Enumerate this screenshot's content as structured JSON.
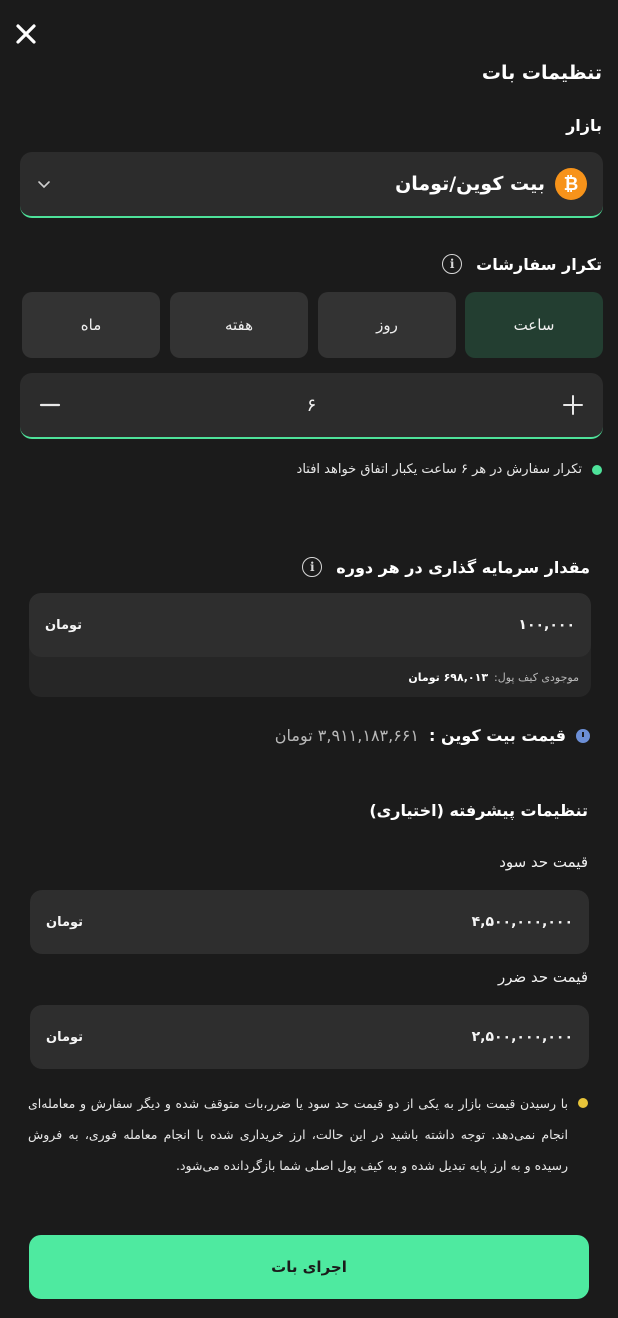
{
  "header": {
    "title": "تنظیمات بات"
  },
  "market": {
    "label": "بازار",
    "selected": "بیت کوین/تومان",
    "coin_icon": "bitcoin-icon"
  },
  "frequency": {
    "label": "تکرار سفارشات",
    "tabs": [
      {
        "label": "ساعت",
        "active": true
      },
      {
        "label": "روز",
        "active": false
      },
      {
        "label": "هفته",
        "active": false
      },
      {
        "label": "ماه",
        "active": false
      }
    ],
    "value": "۶",
    "note": "تکرار سفارش در هر ۶ ساعت یکبار اتفاق خواهد افتاد"
  },
  "investment": {
    "label": "مقدار سرمایه گذاری در هر دوره",
    "amount": "۱۰۰,۰۰۰",
    "unit": "تومان",
    "wallet_label": "موجودی کیف پول:",
    "wallet_value": "۶۹۸,۰۱۳ تومان"
  },
  "price": {
    "label": "قیمت بیت کوین :",
    "value": "۳,۹۱۱,۱۸۳,۶۶۱ تومان"
  },
  "advanced": {
    "title": "تنظیمات پیشرفته (اختیاری)",
    "take_profit_label": "قیمت حد سود",
    "take_profit_value": "۴,۵۰۰,۰۰۰,۰۰۰",
    "stop_loss_label": "قیمت حد ضرر",
    "stop_loss_value": "۲,۵۰۰,۰۰۰,۰۰۰",
    "unit": "تومان"
  },
  "warning": "با رسیدن قیمت بازار به یکی از دو قیمت حد سود یا ضرر،بات متوقف شده و دیگر سفارش و معامله‌ای انجام نمی‌دهد. توجه داشته باشید در این حالت، ارز خریداری شده با انجام معامله فوری، به فروش رسیده و به ارز پایه تبدیل شده و به کیف پول اصلی شما بازگردانده می‌شود.",
  "actions": {
    "run_label": "اجرای بات"
  },
  "colors": {
    "accent": "#4eeaa0",
    "active_tab": "#233e31",
    "note_dot": "#4ee29a",
    "warning_dot": "#e8c53a",
    "bitcoin": "#f7931a"
  }
}
